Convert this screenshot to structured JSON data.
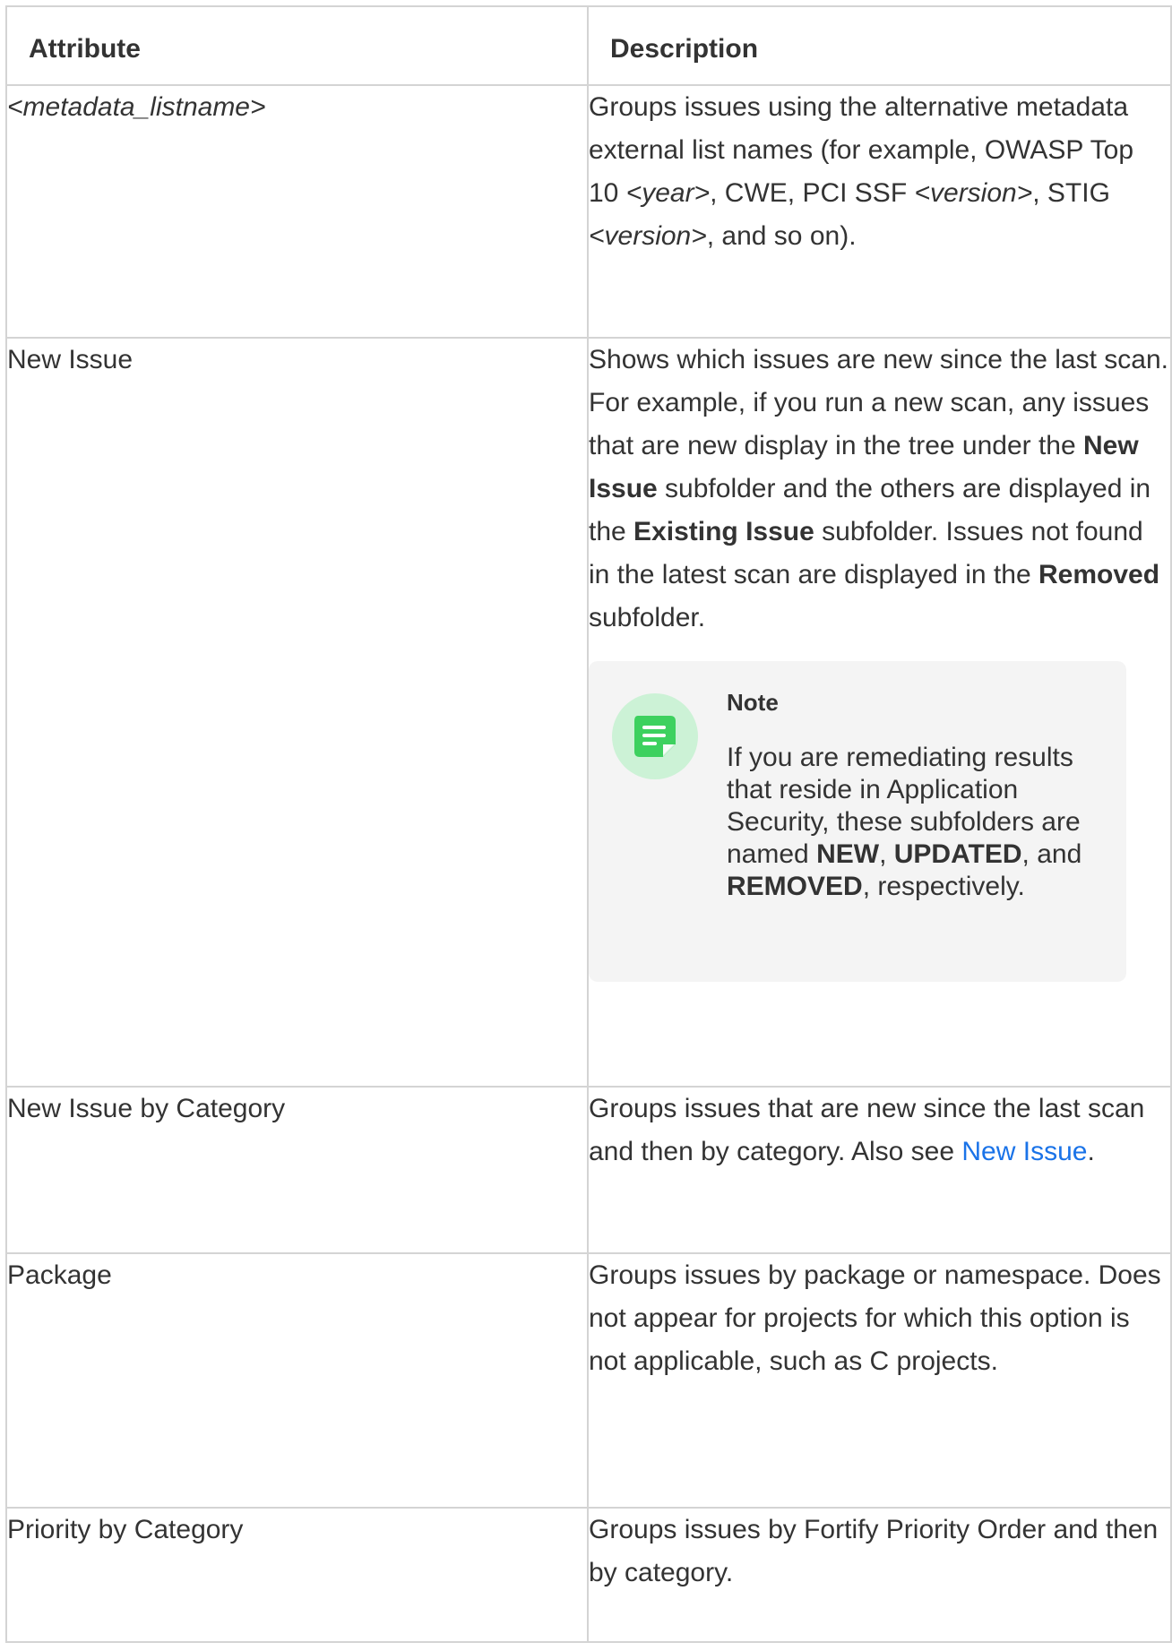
{
  "table": {
    "headers": {
      "attribute": "Attribute",
      "description": "Description"
    },
    "rows": [
      {
        "attribute": "<metadata_listname>",
        "desc_parts": {
          "p1": "Groups issues using the alternative metadata external list names (for example, OWASP Top 10 ",
          "i1": "<year>",
          "p2": ", CWE, PCI SSF ",
          "i2": "<version>",
          "p3": ", STIG ",
          "i3": "<version>",
          "p4": ", and so on)."
        }
      },
      {
        "attribute": "New Issue",
        "desc_parts": {
          "p1": "Shows which issues are new since the last scan. For example, if you run a new scan, any issues that are new display in the tree under the ",
          "b1": "New Issue",
          "p2": " subfolder and the others are displayed in the ",
          "b2": "Existing Issue",
          "p3": " subfolder. Issues not found in the latest scan are displayed in the ",
          "b3": "Removed",
          "p4": " subfolder."
        },
        "note": {
          "title": "Note",
          "icon": "note-icon",
          "p1": "If you are remediating results that reside in Application Security, these subfolders are named ",
          "b1": "NEW",
          "p2": ", ",
          "b2": "UPDATED",
          "p3": ", and ",
          "b3": "REMOVED",
          "p4": ", respectively."
        }
      },
      {
        "attribute": "New Issue by Category",
        "desc_parts": {
          "p1": "Groups issues that are new since the last scan and then by category. Also see ",
          "link": "New Issue",
          "p2": "."
        }
      },
      {
        "attribute": "Package",
        "description": "Groups issues by package or namespace. Does not appear for projects for which this option is not applicable, such as C projects."
      },
      {
        "attribute": "Priority by Category",
        "description": "Groups issues by Fortify Priority Order and then by category."
      }
    ]
  },
  "colors": {
    "border": "#d4d4d4",
    "text": "#333333",
    "link": "#1a73e8",
    "note_bg": "#f4f4f4",
    "note_icon_bg": "#ccf2d6",
    "note_icon_fg": "#3dd15f"
  }
}
